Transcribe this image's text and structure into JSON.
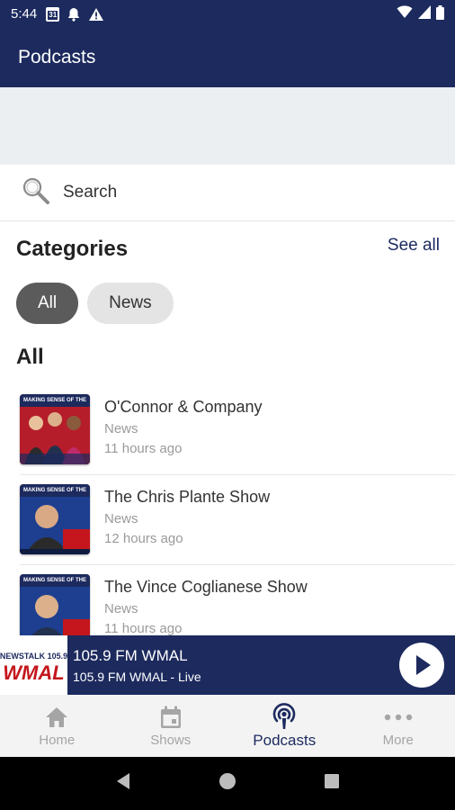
{
  "status_bar": {
    "time": "5:44",
    "calendar_day": "31"
  },
  "app_bar": {
    "title": "Podcasts"
  },
  "search": {
    "label": "Search"
  },
  "categories": {
    "title": "Categories",
    "see_all": "See all",
    "chips": [
      {
        "label": "All",
        "selected": true
      },
      {
        "label": "News",
        "selected": false
      }
    ]
  },
  "section": {
    "title": "All"
  },
  "podcasts": [
    {
      "title": "O'Connor & Company",
      "category": "News",
      "time": "11 hours ago",
      "thumb_banner": "MAKING SENSE OF THE NEWS"
    },
    {
      "title": "The Chris Plante Show",
      "category": "News",
      "time": "12 hours ago",
      "thumb_banner": "MAKING SENSE OF THE NEWS"
    },
    {
      "title": "The Vince Coglianese Show",
      "category": "News",
      "time": "11 hours ago",
      "thumb_banner": "MAKING SENSE OF THE NEWS"
    }
  ],
  "player": {
    "logo_top": "NEWSTALK 105.9",
    "logo_main": "WMAL",
    "title": "105.9 FM WMAL",
    "subtitle": "105.9 FM WMAL - Live"
  },
  "bottom_nav": [
    {
      "label": "Home",
      "icon": "home-icon",
      "active": false
    },
    {
      "label": "Shows",
      "icon": "calendar-icon",
      "active": false
    },
    {
      "label": "Podcasts",
      "icon": "podcast-icon",
      "active": true
    },
    {
      "label": "More",
      "icon": "more-icon",
      "active": false
    }
  ],
  "colors": {
    "primary": "#1c2a5e",
    "chip_active": "#5b5b5b",
    "chip_inactive": "#e4e4e4",
    "brand_red": "#c4161c"
  }
}
